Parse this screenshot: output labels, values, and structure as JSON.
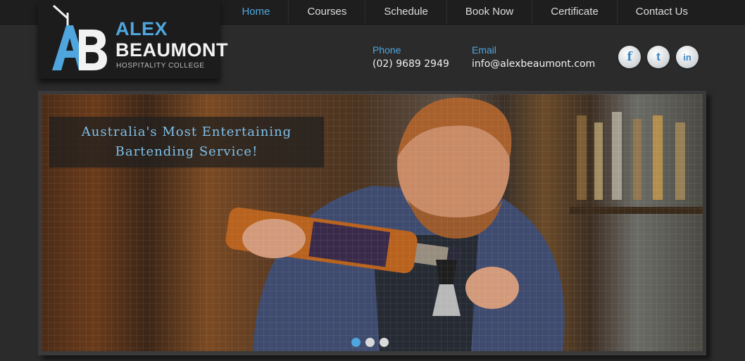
{
  "nav": {
    "items": [
      {
        "label": "Home",
        "active": true
      },
      {
        "label": "Courses",
        "active": false
      },
      {
        "label": "Schedule",
        "active": false
      },
      {
        "label": "Book Now",
        "active": false
      },
      {
        "label": "Certificate",
        "active": false
      },
      {
        "label": "Contact Us",
        "active": false
      }
    ]
  },
  "logo": {
    "mark": "AB",
    "name_line1": "ALEX",
    "name_line2": "BEAUMONT",
    "subtitle": "HOSPITALITY COLLEGE"
  },
  "contact": {
    "phone_label": "Phone",
    "phone_value": "(02) 9689 2949",
    "email_label": "Email",
    "email_value": "info@alexbeaumont.com"
  },
  "social": [
    {
      "icon": "facebook-icon",
      "glyph": "f"
    },
    {
      "icon": "twitter-icon",
      "glyph": "t"
    },
    {
      "icon": "linkedin-icon",
      "glyph": "in"
    }
  ],
  "slider": {
    "caption_line1": "Australia's Most Entertaining",
    "caption_line2": "Bartending Service!",
    "slide_count": 3,
    "active_slide": 1
  },
  "colors": {
    "accent": "#4fa6df",
    "background": "#2b2b2b",
    "topbar": "#1e1e1e"
  }
}
